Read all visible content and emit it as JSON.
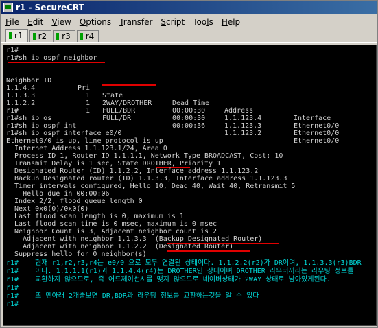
{
  "window": {
    "title": "r1 - SecureCRT"
  },
  "menu": [
    {
      "u": "F",
      "rest": "ile"
    },
    {
      "u": "E",
      "rest": "dit"
    },
    {
      "u": "V",
      "rest": "iew"
    },
    {
      "u": "O",
      "rest": "ptions"
    },
    {
      "u": "T",
      "rest": "ransfer"
    },
    {
      "u": "S",
      "rest": "cript"
    },
    {
      "u": "",
      "rest": "Too",
      "u2": "l",
      "rest2": "s"
    },
    {
      "u": "H",
      "rest": "elp"
    }
  ],
  "tabs": [
    "r1",
    "r2",
    "r3",
    "r4"
  ],
  "terminal": {
    "l1": "r1#",
    "l2": "r1#sh ip ospf neighbor",
    "neighbor_header": {
      "id": "Neighbor ID",
      "pri": "Pri",
      "state": "State",
      "dead": "Dead Time",
      "address": "Address",
      "interface": "Interface"
    },
    "neighbors": [
      {
        "id": "1.1.4.4",
        "pri": "1",
        "state": "2WAY/DROTHER",
        "dead": "00:00:30",
        "address": "1.1.123.4",
        "interface": "Ethernet0/0"
      },
      {
        "id": "1.1.3.3",
        "pri": "1",
        "state": "FULL/BDR",
        "dead": "00:00:30",
        "address": "1.1.123.3",
        "interface": "Ethernet0/0"
      },
      {
        "id": "1.1.2.2",
        "pri": "1",
        "state": "FULL/DR",
        "dead": "00:00:36",
        "address": "1.1.123.2",
        "interface": "Ethernet0/0"
      }
    ],
    "l7": "r1#",
    "l8": "r1#sh ip os",
    "l9": "r1#sh ip ospf int",
    "l10": "r1#sh ip ospf interface e0/0",
    "l11": "Ethernet0/0 is up, line protocol is up",
    "l12": "  Internet Address 1.1.123.1/24, Area 0",
    "l13": "  Process ID 1, Router ID 1.1.1.1, Network Type BROADCAST, Cost: 10",
    "l14": "  Transmit Delay is 1 sec, State DROTHER, Priority 1",
    "l15": "  Designated Router (ID) 1.1.2.2, Interface address 1.1.123.2",
    "l16": "  Backup Designated router (ID) 1.1.3.3, Interface address 1.1.123.3",
    "l17": "  Timer intervals configured, Hello 10, Dead 40, Wait 40, Retransmit 5",
    "l18": "    Hello due in 00:00:06",
    "l19": "  Index 2/2, flood queue length 0",
    "l20": "  Next 0x0(0)/0x0(0)",
    "l21": "  Last flood scan length is 0, maximum is 1",
    "l22": "  Last flood scan time is 0 msec, maximum is 0 msec",
    "l23": "  Neighbor Count is 3, Adjacent neighbor count is 2",
    "l24": "    Adjacent with neighbor 1.1.3.3  (Backup Designated Router)",
    "l25": "    Adjacent with neighbor 1.1.2.2  (Designated Router)",
    "l26": "  Suppress hello for 0 neighbor(s)",
    "k1": "r1#    현재 r1,r2,r3,r4는 e0/0 으로 모두 연결된 상태이다. 1.1.2.2(r2)가 DR이며, 1.1.3.3(r3)BDR",
    "k2": "r1#    이다. 1.1.1.1(r1)과 1.1.4.4(r4)는 DROTHER인 상태이며 DROTHER 라우터끼리는 라우팅 정보를",
    "k3": "r1#    교환하지 않으므로, 즉 어드제이선시를 맺지 않으므로 네이버상태가 2WAY 상태로 남아있게된다.",
    "k4": "r1#",
    "k5": "r1#    또 맨아래 2개줄보면 DR,BDR과 라우팅 정보를 교환하는것을 알 수 있다",
    "k6": "r1#"
  },
  "colors": {
    "terminal_bg": "#000000",
    "terminal_fg": "#d0d0d0",
    "note_fg": "#00d8d8",
    "highlight": "#e00000",
    "title_start": "#0a246a",
    "title_end": "#3a6ea5"
  }
}
